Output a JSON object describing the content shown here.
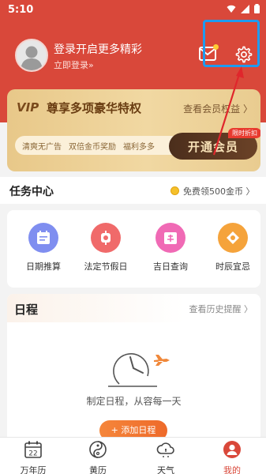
{
  "status": {
    "time": "5:10"
  },
  "profile": {
    "title": "登录开启更多精彩",
    "subtitle": "立即登录»"
  },
  "vip": {
    "logo": "VIP",
    "title": "尊享多项豪华特权",
    "link": "查看会员权益 〉",
    "benefits": [
      "清爽无广告",
      "双倍金币奖励",
      "福利多多"
    ],
    "button": "开通会员",
    "badge": "限时折扣"
  },
  "tasks": {
    "title": "任务中心",
    "link": "免费领500金币 〉"
  },
  "tools": [
    {
      "label": "日期推算",
      "icon": "calendar-calc-icon",
      "color": "#7f8ef0"
    },
    {
      "label": "法定节假日",
      "icon": "lantern-icon",
      "color": "#f06a6a"
    },
    {
      "label": "吉日查询",
      "icon": "lucky-day-icon",
      "color": "#f06ab5"
    },
    {
      "label": "时辰宜忌",
      "icon": "hour-icon",
      "color": "#f5a33b"
    }
  ],
  "schedule": {
    "title": "日程",
    "link": "查看历史提醒 〉",
    "empty_text": "制定日程，从容每一天",
    "add_button": "+ 添加日程"
  },
  "tabs": [
    {
      "label": "万年历",
      "icon": "calendar-22-icon",
      "day": "22"
    },
    {
      "label": "黄历",
      "icon": "yinyang-icon"
    },
    {
      "label": "天气",
      "icon": "weather-icon"
    },
    {
      "label": "我的",
      "icon": "profile-icon"
    }
  ],
  "colors": {
    "primary": "#d9483a",
    "highlight": "#1e9bf0",
    "gold": "#e8c889"
  }
}
